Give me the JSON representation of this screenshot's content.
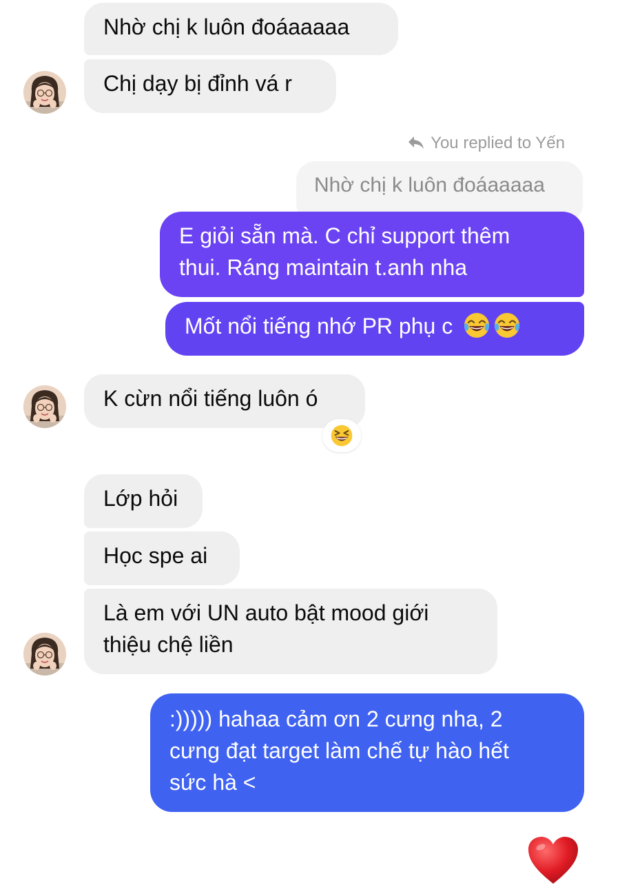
{
  "messages": {
    "m1": "Nhờ chị k luôn đoáaaaaa",
    "m2": "Chị dạy bị đỉnh vá r",
    "reply_label": "You replied to Yến",
    "quoted": "Nhờ chị k luôn đoáaaaaa",
    "m3_line1": "E giỏi sẵn mà. C chỉ support thêm",
    "m3_line2": "thui. Ráng maintain t.anh nha",
    "m4": "Mốt nổi tiếng nhớ PR phụ c",
    "m5": "K cừn nổi tiếng luôn ó",
    "m6": "Lớp hỏi",
    "m7": "Học spe ai",
    "m8_line1": "Là em với UN auto bật mood giới",
    "m8_line2": "thiệu chệ liền",
    "m9_line1": ":))))) hahaa cảm ơn 2 cưng nha, 2",
    "m9_line2": "cưng đạt target làm chế tự hào hết",
    "m9_line3": "sức hà <"
  },
  "icons": {
    "reply": "reply-arrow-icon",
    "laugh": "face-with-tears-of-joy-emoji",
    "reaction": "grinning-squinting-face-emoji",
    "heart": "red-heart-emoji",
    "avatar": "contact-avatar"
  },
  "colors": {
    "incoming_bg": "#efefef",
    "outgoing_purple": "#6b43f2",
    "outgoing_blue": "#3f62f0",
    "meta_text": "#9b9b9b"
  }
}
